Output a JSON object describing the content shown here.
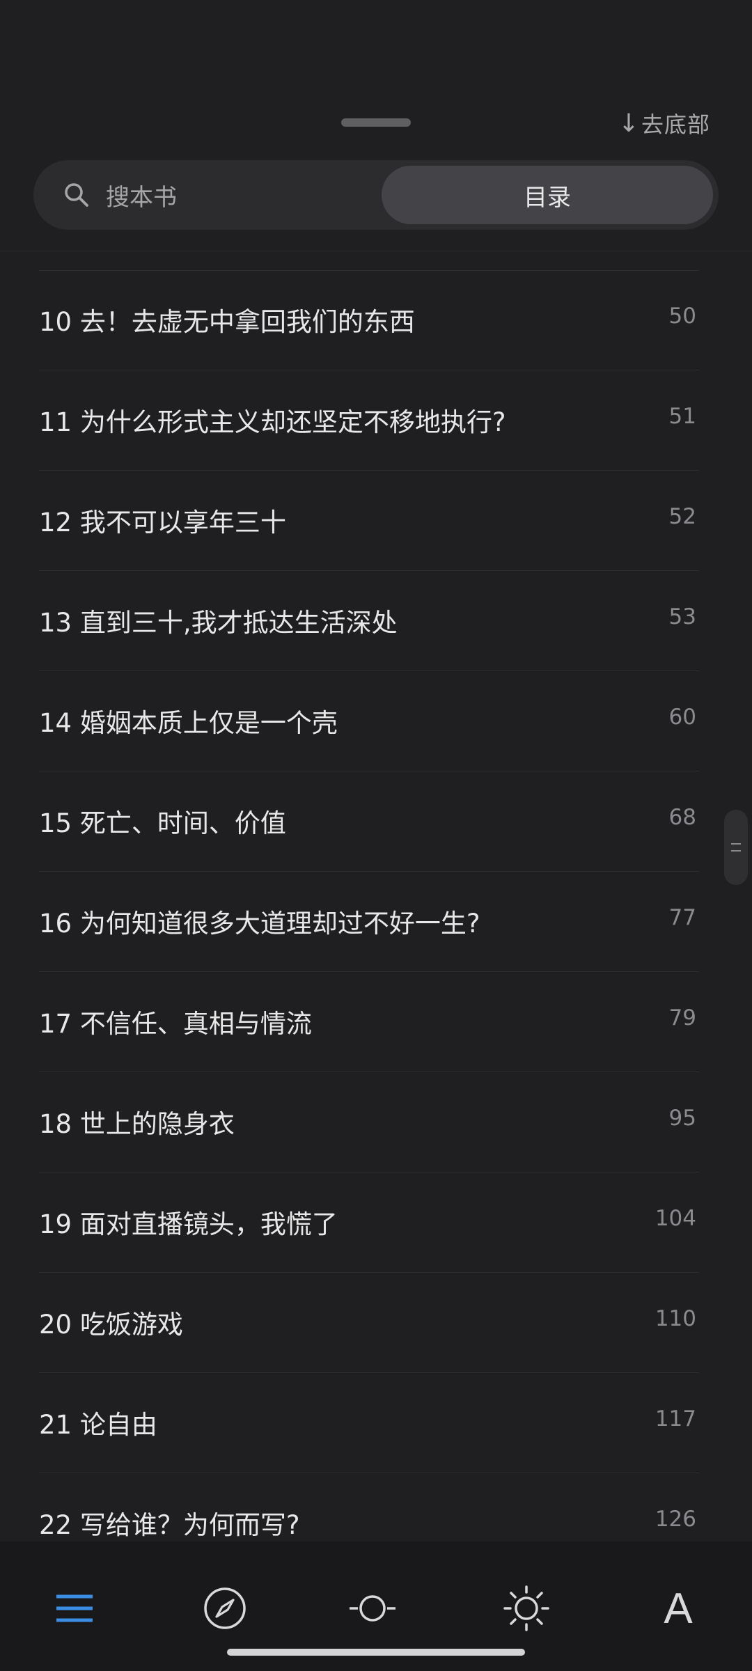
{
  "header": {
    "to_bottom_arrow": "↓",
    "to_bottom_label": "去底部"
  },
  "tabs": {
    "search_label": "搜本书",
    "toc_label": "目录"
  },
  "chapters": [
    {
      "title": "10 去！去虚无中拿回我们的东西",
      "page": "50"
    },
    {
      "title": "11 为什么形式主义却还坚定不移地执行?",
      "page": "51"
    },
    {
      "title": "12 我不可以享年三十",
      "page": "52"
    },
    {
      "title": "13 直到三十,我才抵达生活深处",
      "page": "53"
    },
    {
      "title": "14 婚姻本质上仅是一个壳",
      "page": "60"
    },
    {
      "title": "15 死亡、时间、价值",
      "page": "68"
    },
    {
      "title": "16 为何知道很多大道理却过不好一生?",
      "page": "77"
    },
    {
      "title": "17 不信任、真相与情流",
      "page": "79"
    },
    {
      "title": "18 世上的隐身衣",
      "page": "95"
    },
    {
      "title": "19 面对直播镜头，我慌了",
      "page": "104"
    },
    {
      "title": "20 吃饭游戏",
      "page": "110"
    },
    {
      "title": "21 论自由",
      "page": "117"
    },
    {
      "title": "22 写给谁？为何而写?",
      "page": "126"
    }
  ],
  "bottom_nav": {
    "font_label": "A"
  },
  "colors": {
    "accent": "#3a8ee6",
    "background": "#1f1f21",
    "bottom_bar": "#19191b"
  }
}
